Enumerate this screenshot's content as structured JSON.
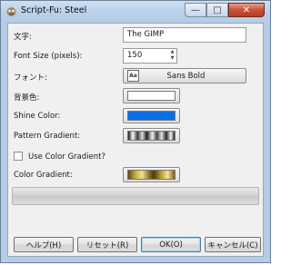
{
  "window": {
    "title": "Script-Fu: Steel"
  },
  "title_buttons": {
    "minimize": "—",
    "maximize": "□",
    "close": "✕"
  },
  "fields": {
    "text": {
      "label": "文字:",
      "value": "The GIMP"
    },
    "font_size": {
      "label": "Font Size (pixels):",
      "value": "150"
    },
    "font": {
      "label": "フォント:",
      "value": "Sans Bold"
    },
    "bg_color": {
      "label": "背景色:"
    },
    "shine_color": {
      "label": "Shine Color:"
    },
    "pattern_gradient": {
      "label": "Pattern Gradient:"
    },
    "use_color_gradient": {
      "label": "Use Color Gradient?",
      "checked": false
    },
    "color_gradient": {
      "label": "Color Gradient:"
    }
  },
  "colors": {
    "background": "#ffffff",
    "shine": "#0a6fe6"
  },
  "progress": {
    "value": 0
  },
  "buttons": {
    "help": "ヘルプ(H)",
    "reset": "リセット(R)",
    "ok": "OK(O)",
    "cancel": "キャンセル(C)"
  }
}
